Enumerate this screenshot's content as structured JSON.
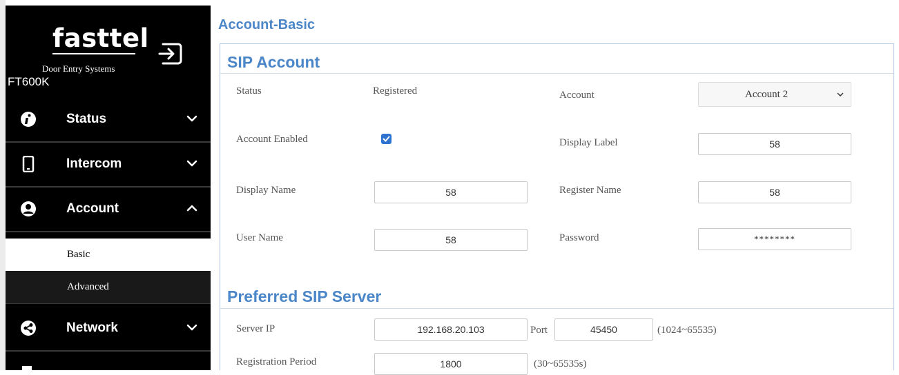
{
  "sidebar": {
    "logo_text": "fasttel",
    "tagline": "Door Entry Systems",
    "model": "FT600K",
    "items": [
      {
        "label": "Status",
        "icon": "info-icon"
      },
      {
        "label": "Intercom",
        "icon": "phone-icon"
      },
      {
        "label": "Account",
        "icon": "user-icon"
      },
      {
        "label": "Network",
        "icon": "network-icon"
      }
    ],
    "subitems": [
      {
        "label": "Basic"
      },
      {
        "label": "Advanced"
      }
    ]
  },
  "page": {
    "title": "Account-Basic"
  },
  "sip_account": {
    "title": "SIP Account",
    "status_label": "Status",
    "status_value": "Registered",
    "account_label": "Account",
    "account_value": "Account 2",
    "enabled_label": "Account Enabled",
    "enabled": true,
    "display_label_label": "Display Label",
    "display_label_value": "58",
    "display_name_label": "Display Name",
    "display_name_value": "58",
    "register_name_label": "Register Name",
    "register_name_value": "58",
    "user_name_label": "User Name",
    "user_name_value": "58",
    "password_label": "Password",
    "password_value": "********"
  },
  "preferred_sip_server": {
    "title": "Preferred SIP Server",
    "server_ip_label": "Server IP",
    "server_ip_value": "192.168.20.103",
    "port_label": "Port",
    "port_value": "45450",
    "port_range": "(1024~65535)",
    "reg_period_label": "Registration Period",
    "reg_period_value": "1800",
    "reg_period_range": "(30~65535s)"
  },
  "colors": {
    "accent": "#4a86c8",
    "sidebar_bg": "#000000",
    "checkbox": "#2f73d0"
  }
}
